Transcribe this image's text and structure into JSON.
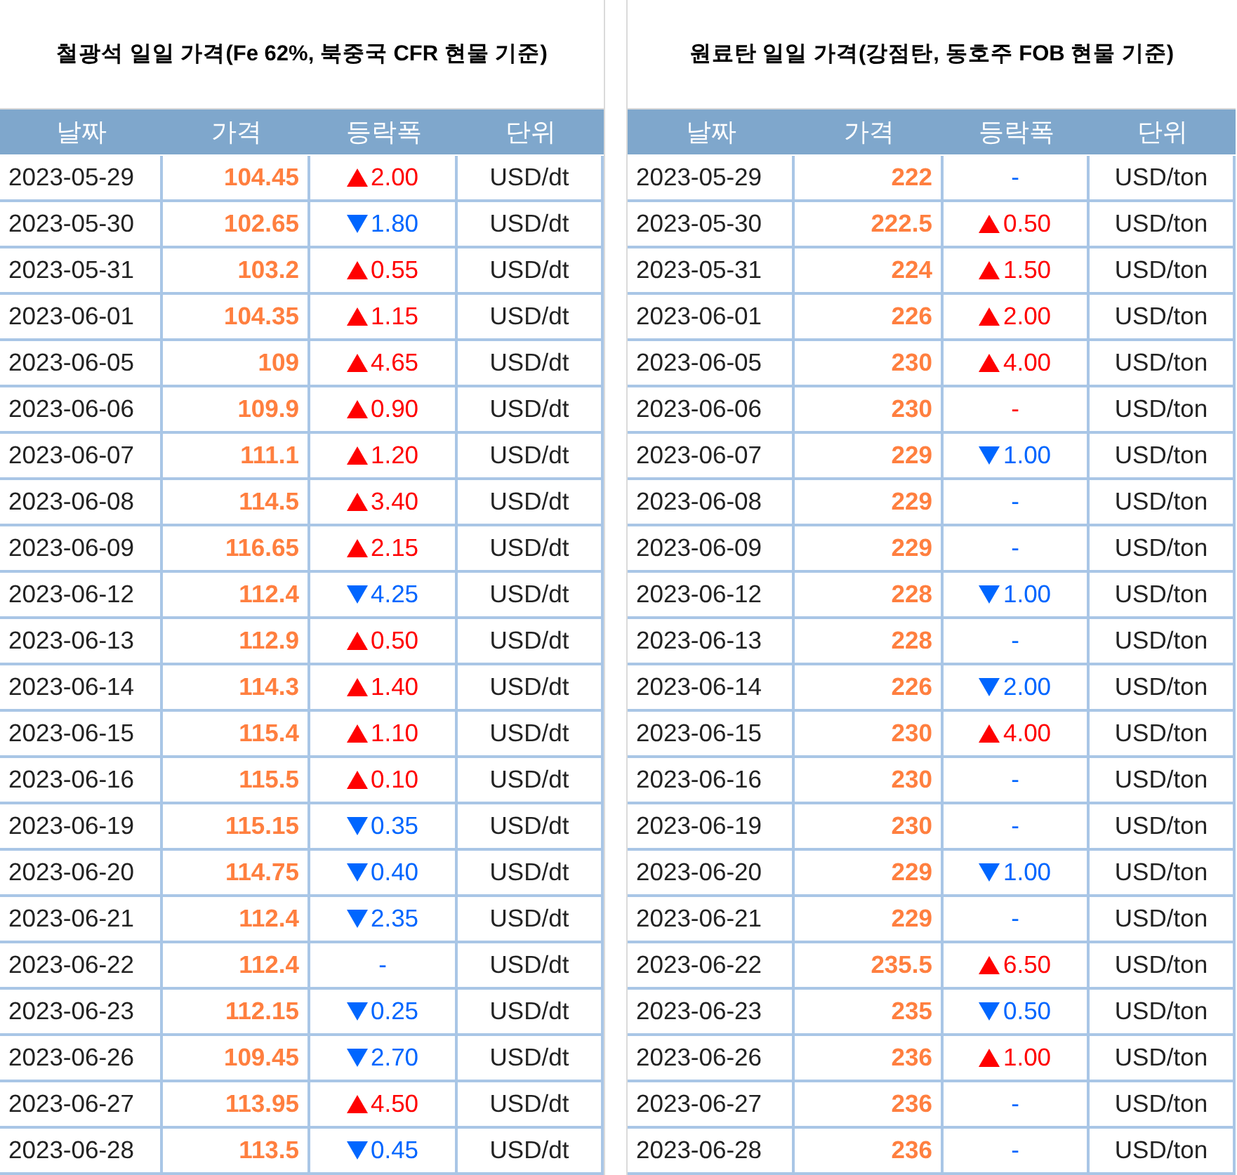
{
  "tables": [
    {
      "title": "철광석 일일 가격(Fe 62%, 북중국 CFR 현물 기준)",
      "columns": [
        "날짜",
        "가격",
        "등락폭",
        "단위"
      ],
      "rows": [
        {
          "date": "2023-05-29",
          "price": "104.45",
          "change": {
            "kind": "up",
            "color": "#ff0000",
            "text": "2.00"
          },
          "unit": "USD/dt"
        },
        {
          "date": "2023-05-30",
          "price": "102.65",
          "change": {
            "kind": "down",
            "color": "#0066ff",
            "text": "1.80"
          },
          "unit": "USD/dt"
        },
        {
          "date": "2023-05-31",
          "price": "103.2",
          "change": {
            "kind": "up",
            "color": "#ff0000",
            "text": "0.55"
          },
          "unit": "USD/dt"
        },
        {
          "date": "2023-06-01",
          "price": "104.35",
          "change": {
            "kind": "up",
            "color": "#ff0000",
            "text": "1.15"
          },
          "unit": "USD/dt"
        },
        {
          "date": "2023-06-05",
          "price": "109",
          "change": {
            "kind": "up",
            "color": "#ff0000",
            "text": "4.65"
          },
          "unit": "USD/dt"
        },
        {
          "date": "2023-06-06",
          "price": "109.9",
          "change": {
            "kind": "up",
            "color": "#ff0000",
            "text": "0.90"
          },
          "unit": "USD/dt"
        },
        {
          "date": "2023-06-07",
          "price": "111.1",
          "change": {
            "kind": "up",
            "color": "#ff0000",
            "text": "1.20"
          },
          "unit": "USD/dt"
        },
        {
          "date": "2023-06-08",
          "price": "114.5",
          "change": {
            "kind": "up",
            "color": "#ff0000",
            "text": "3.40"
          },
          "unit": "USD/dt"
        },
        {
          "date": "2023-06-09",
          "price": "116.65",
          "change": {
            "kind": "up",
            "color": "#ff0000",
            "text": "2.15"
          },
          "unit": "USD/dt"
        },
        {
          "date": "2023-06-12",
          "price": "112.4",
          "change": {
            "kind": "down",
            "color": "#0066ff",
            "text": "4.25"
          },
          "unit": "USD/dt"
        },
        {
          "date": "2023-06-13",
          "price": "112.9",
          "change": {
            "kind": "up",
            "color": "#ff0000",
            "text": "0.50"
          },
          "unit": "USD/dt"
        },
        {
          "date": "2023-06-14",
          "price": "114.3",
          "change": {
            "kind": "up",
            "color": "#ff0000",
            "text": "1.40"
          },
          "unit": "USD/dt"
        },
        {
          "date": "2023-06-15",
          "price": "115.4",
          "change": {
            "kind": "up",
            "color": "#ff0000",
            "text": "1.10"
          },
          "unit": "USD/dt"
        },
        {
          "date": "2023-06-16",
          "price": "115.5",
          "change": {
            "kind": "up",
            "color": "#ff0000",
            "text": "0.10"
          },
          "unit": "USD/dt"
        },
        {
          "date": "2023-06-19",
          "price": "115.15",
          "change": {
            "kind": "down",
            "color": "#0066ff",
            "text": "0.35"
          },
          "unit": "USD/dt"
        },
        {
          "date": "2023-06-20",
          "price": "114.75",
          "change": {
            "kind": "down",
            "color": "#0066ff",
            "text": "0.40"
          },
          "unit": "USD/dt"
        },
        {
          "date": "2023-06-21",
          "price": "112.4",
          "change": {
            "kind": "down",
            "color": "#0066ff",
            "text": "2.35"
          },
          "unit": "USD/dt"
        },
        {
          "date": "2023-06-22",
          "price": "112.4",
          "change": {
            "kind": "none",
            "color": "#0066ff",
            "text": "-"
          },
          "unit": "USD/dt"
        },
        {
          "date": "2023-06-23",
          "price": "112.15",
          "change": {
            "kind": "down",
            "color": "#0066ff",
            "text": "0.25"
          },
          "unit": "USD/dt"
        },
        {
          "date": "2023-06-26",
          "price": "109.45",
          "change": {
            "kind": "down",
            "color": "#0066ff",
            "text": "2.70"
          },
          "unit": "USD/dt"
        },
        {
          "date": "2023-06-27",
          "price": "113.95",
          "change": {
            "kind": "up",
            "color": "#ff0000",
            "text": "4.50"
          },
          "unit": "USD/dt"
        },
        {
          "date": "2023-06-28",
          "price": "113.5",
          "change": {
            "kind": "down",
            "color": "#0066ff",
            "text": "0.45"
          },
          "unit": "USD/dt"
        }
      ]
    },
    {
      "title": "원료탄 일일 가격(강점탄, 동호주 FOB 현물 기준)",
      "columns": [
        "날짜",
        "가격",
        "등락폭",
        "단위"
      ],
      "rows": [
        {
          "date": "2023-05-29",
          "price": "222",
          "change": {
            "kind": "none",
            "color": "#0066ff",
            "text": "-"
          },
          "unit": "USD/ton"
        },
        {
          "date": "2023-05-30",
          "price": "222.5",
          "change": {
            "kind": "up",
            "color": "#ff0000",
            "text": "0.50"
          },
          "unit": "USD/ton"
        },
        {
          "date": "2023-05-31",
          "price": "224",
          "change": {
            "kind": "up",
            "color": "#ff0000",
            "text": "1.50"
          },
          "unit": "USD/ton"
        },
        {
          "date": "2023-06-01",
          "price": "226",
          "change": {
            "kind": "up",
            "color": "#ff0000",
            "text": "2.00"
          },
          "unit": "USD/ton"
        },
        {
          "date": "2023-06-05",
          "price": "230",
          "change": {
            "kind": "up",
            "color": "#ff0000",
            "text": "4.00"
          },
          "unit": "USD/ton"
        },
        {
          "date": "2023-06-06",
          "price": "230",
          "change": {
            "kind": "none",
            "color": "#ff0000",
            "text": "-"
          },
          "unit": "USD/ton"
        },
        {
          "date": "2023-06-07",
          "price": "229",
          "change": {
            "kind": "down",
            "color": "#0066ff",
            "text": "1.00"
          },
          "unit": "USD/ton"
        },
        {
          "date": "2023-06-08",
          "price": "229",
          "change": {
            "kind": "none",
            "color": "#0066ff",
            "text": "-"
          },
          "unit": "USD/ton"
        },
        {
          "date": "2023-06-09",
          "price": "229",
          "change": {
            "kind": "none",
            "color": "#0066ff",
            "text": "-"
          },
          "unit": "USD/ton"
        },
        {
          "date": "2023-06-12",
          "price": "228",
          "change": {
            "kind": "down",
            "color": "#0066ff",
            "text": "1.00"
          },
          "unit": "USD/ton"
        },
        {
          "date": "2023-06-13",
          "price": "228",
          "change": {
            "kind": "none",
            "color": "#0066ff",
            "text": "-"
          },
          "unit": "USD/ton"
        },
        {
          "date": "2023-06-14",
          "price": "226",
          "change": {
            "kind": "down",
            "color": "#0066ff",
            "text": "2.00"
          },
          "unit": "USD/ton"
        },
        {
          "date": "2023-06-15",
          "price": "230",
          "change": {
            "kind": "up",
            "color": "#ff0000",
            "text": "4.00"
          },
          "unit": "USD/ton"
        },
        {
          "date": "2023-06-16",
          "price": "230",
          "change": {
            "kind": "none",
            "color": "#0066ff",
            "text": "-"
          },
          "unit": "USD/ton"
        },
        {
          "date": "2023-06-19",
          "price": "230",
          "change": {
            "kind": "none",
            "color": "#0066ff",
            "text": "-"
          },
          "unit": "USD/ton"
        },
        {
          "date": "2023-06-20",
          "price": "229",
          "change": {
            "kind": "down",
            "color": "#0066ff",
            "text": "1.00"
          },
          "unit": "USD/ton"
        },
        {
          "date": "2023-06-21",
          "price": "229",
          "change": {
            "kind": "none",
            "color": "#0066ff",
            "text": "-"
          },
          "unit": "USD/ton"
        },
        {
          "date": "2023-06-22",
          "price": "235.5",
          "change": {
            "kind": "up",
            "color": "#ff0000",
            "text": "6.50"
          },
          "unit": "USD/ton"
        },
        {
          "date": "2023-06-23",
          "price": "235",
          "change": {
            "kind": "down",
            "color": "#0066ff",
            "text": "0.50"
          },
          "unit": "USD/ton"
        },
        {
          "date": "2023-06-26",
          "price": "236",
          "change": {
            "kind": "up",
            "color": "#ff0000",
            "text": "1.00"
          },
          "unit": "USD/ton"
        },
        {
          "date": "2023-06-27",
          "price": "236",
          "change": {
            "kind": "none",
            "color": "#0066ff",
            "text": "-"
          },
          "unit": "USD/ton"
        },
        {
          "date": "2023-06-28",
          "price": "236",
          "change": {
            "kind": "none",
            "color": "#0066ff",
            "text": "-"
          },
          "unit": "USD/ton"
        }
      ]
    }
  ]
}
